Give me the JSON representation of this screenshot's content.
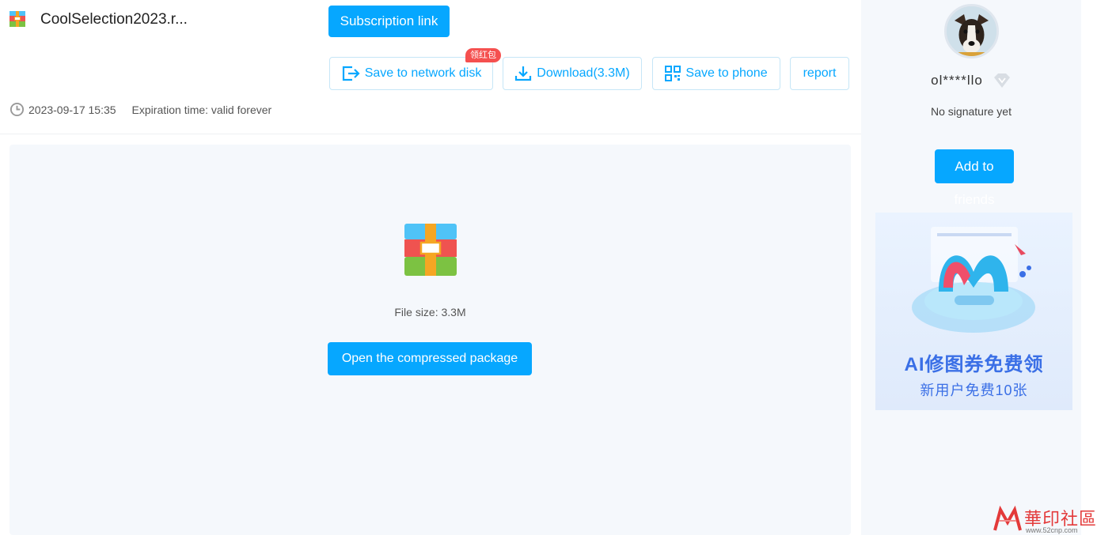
{
  "file": {
    "title": "CoolSelection2023.r...",
    "date": "2023-09-17 15:35",
    "expiration": "Expiration time: valid forever",
    "size_label": "File size: 3.3M",
    "icon": "archive-icon"
  },
  "buttons": {
    "subscription": "Subscription link",
    "save_disk": "Save to network disk",
    "download": "Download(3.3M)",
    "save_phone": "Save to phone",
    "report": "report",
    "open_package": "Open the compressed package"
  },
  "badge": {
    "red_packet": "领红包"
  },
  "sidebar": {
    "username": "ol****llo",
    "signature": "No signature yet",
    "add_button": "Add to",
    "add_button_overflow": "friends"
  },
  "ad": {
    "title": "AI修图券免费领",
    "subtitle": "新用户免费10张"
  },
  "watermark": {
    "text": "華印社區",
    "url": "www.52cnp.com"
  },
  "colors": {
    "accent": "#06a7ff",
    "badge": "#f5504f",
    "panel_bg": "#f5f8fc"
  }
}
